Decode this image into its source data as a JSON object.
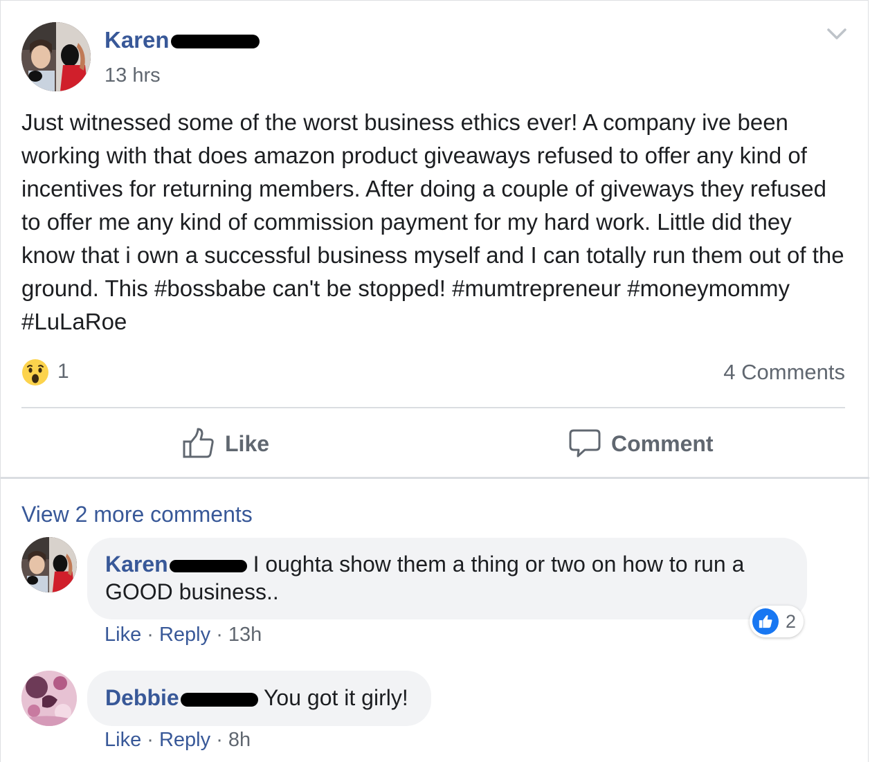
{
  "post": {
    "author_name": "Karen",
    "timestamp": "13 hrs",
    "text": "Just witnessed some of the worst business ethics ever! A company ive been working with that does amazon product giveaways refused to offer any kind of incentives for returning members. After doing a couple of giveways they refused to offer me any kind of commission payment for my hard work. Little did they know that i own a successful business myself and I can totally run them out of the ground. This #bossbabe can't be stopped! #mumtrepreneur #moneymommy #LuLaRoe",
    "reactions": {
      "icon": "wow-emoji-icon",
      "count": "1"
    },
    "comments_count": "4 Comments"
  },
  "actions": {
    "like_label": "Like",
    "comment_label": "Comment"
  },
  "comments_section": {
    "view_more": "View 2 more comments",
    "comments": [
      {
        "author": "Karen",
        "text": "I oughta show them a thing or two on how to run a GOOD business..",
        "like_label": "Like",
        "reply_label": "Reply",
        "time": "13h",
        "reaction_count": "2",
        "reaction_icon": "thumbs-up-icon"
      },
      {
        "author": "Debbie",
        "text": "You got it girly!",
        "like_label": "Like",
        "reply_label": "Reply",
        "time": "8h"
      }
    ]
  },
  "colors": {
    "link_blue": "#385898",
    "secondary_text": "#606770",
    "bubble_bg": "#f2f3f5",
    "like_blue": "#1877f2"
  }
}
